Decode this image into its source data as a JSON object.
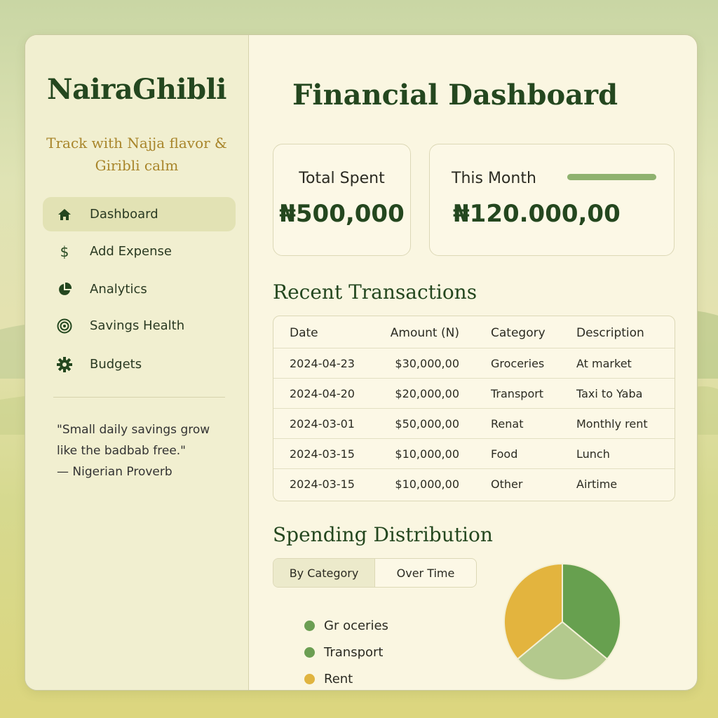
{
  "app": {
    "name": "NairaGhibli",
    "tagline": "Track with Najja flavor & Giribli calm"
  },
  "sidebar": {
    "items": [
      {
        "label": "Dashboard",
        "icon": "home-icon",
        "active": true
      },
      {
        "label": "Add Expense",
        "icon": "dollar-icon",
        "active": false
      },
      {
        "label": "Analytics",
        "icon": "pie-chart-icon",
        "active": false
      },
      {
        "label": "Savings Health",
        "icon": "target-icon",
        "active": false
      },
      {
        "label": "Budgets",
        "icon": "gear-icon",
        "active": false
      }
    ],
    "quote": {
      "line1": "\"Small daily savings grow",
      "line2": "like the badbab free.\"",
      "line3": "— Nigerian Proverb"
    }
  },
  "main": {
    "title": "Financial Dashboard",
    "cards": {
      "total": {
        "label": "Total Spent",
        "value": "₦500,000"
      },
      "month": {
        "label": "This Month",
        "value": "₦120.000,00"
      }
    },
    "transactions": {
      "title": "Recent Transactions",
      "headers": {
        "date": "Date",
        "amount": "Amount (N)",
        "category": "Category",
        "description": "Description"
      },
      "rows": [
        {
          "date": "2024-04-23",
          "amount": "$30,000,00",
          "category": "Groceries",
          "description": "At market"
        },
        {
          "date": "2024-04-20",
          "amount": "$20,000,00",
          "category": "Transport",
          "description": "Taxi to Yaba"
        },
        {
          "date": "2024-03-01",
          "amount": "$50,000,00",
          "category": "Renat",
          "description": "Monthly rent"
        },
        {
          "date": "2024-03-15",
          "amount": "$10,000,00",
          "category": "Food",
          "description": "Lunch"
        },
        {
          "date": "2024-03-15",
          "amount": "$10,000,00",
          "category": "Other",
          "description": "Airtime"
        }
      ]
    },
    "distribution": {
      "title": "Spending Distribution",
      "tabs": {
        "by_category": "By Category",
        "over_time": "Over Time",
        "active": "By Category"
      },
      "legend": [
        {
          "label": "Gr oceries",
          "color": "#6b9e52"
        },
        {
          "label": "Transport",
          "color": "#6b9e52"
        },
        {
          "label": "Rent",
          "color": "#e0b43f"
        }
      ]
    }
  },
  "chart_data": {
    "type": "pie",
    "slices": [
      {
        "value": 36,
        "color": "#67a04f"
      },
      {
        "value": 28,
        "color": "#b3c98d"
      },
      {
        "value": 36,
        "color": "#e3b43e"
      }
    ]
  }
}
